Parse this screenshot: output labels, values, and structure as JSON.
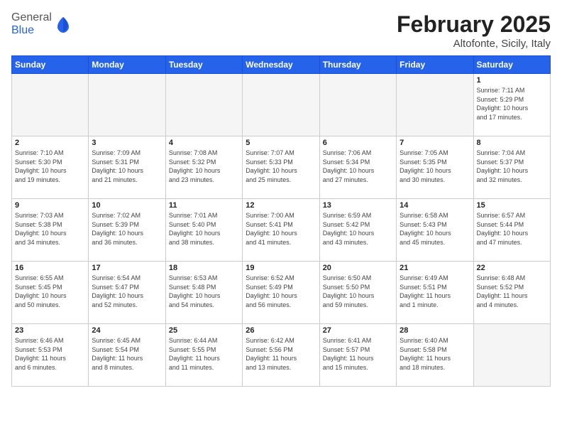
{
  "header": {
    "logo_general": "General",
    "logo_blue": "Blue",
    "month_title": "February 2025",
    "location": "Altofonte, Sicily, Italy"
  },
  "days_of_week": [
    "Sunday",
    "Monday",
    "Tuesday",
    "Wednesday",
    "Thursday",
    "Friday",
    "Saturday"
  ],
  "weeks": [
    [
      {
        "day": "",
        "info": ""
      },
      {
        "day": "",
        "info": ""
      },
      {
        "day": "",
        "info": ""
      },
      {
        "day": "",
        "info": ""
      },
      {
        "day": "",
        "info": ""
      },
      {
        "day": "",
        "info": ""
      },
      {
        "day": "1",
        "info": "Sunrise: 7:11 AM\nSunset: 5:29 PM\nDaylight: 10 hours\nand 17 minutes."
      }
    ],
    [
      {
        "day": "2",
        "info": "Sunrise: 7:10 AM\nSunset: 5:30 PM\nDaylight: 10 hours\nand 19 minutes."
      },
      {
        "day": "3",
        "info": "Sunrise: 7:09 AM\nSunset: 5:31 PM\nDaylight: 10 hours\nand 21 minutes."
      },
      {
        "day": "4",
        "info": "Sunrise: 7:08 AM\nSunset: 5:32 PM\nDaylight: 10 hours\nand 23 minutes."
      },
      {
        "day": "5",
        "info": "Sunrise: 7:07 AM\nSunset: 5:33 PM\nDaylight: 10 hours\nand 25 minutes."
      },
      {
        "day": "6",
        "info": "Sunrise: 7:06 AM\nSunset: 5:34 PM\nDaylight: 10 hours\nand 27 minutes."
      },
      {
        "day": "7",
        "info": "Sunrise: 7:05 AM\nSunset: 5:35 PM\nDaylight: 10 hours\nand 30 minutes."
      },
      {
        "day": "8",
        "info": "Sunrise: 7:04 AM\nSunset: 5:37 PM\nDaylight: 10 hours\nand 32 minutes."
      }
    ],
    [
      {
        "day": "9",
        "info": "Sunrise: 7:03 AM\nSunset: 5:38 PM\nDaylight: 10 hours\nand 34 minutes."
      },
      {
        "day": "10",
        "info": "Sunrise: 7:02 AM\nSunset: 5:39 PM\nDaylight: 10 hours\nand 36 minutes."
      },
      {
        "day": "11",
        "info": "Sunrise: 7:01 AM\nSunset: 5:40 PM\nDaylight: 10 hours\nand 38 minutes."
      },
      {
        "day": "12",
        "info": "Sunrise: 7:00 AM\nSunset: 5:41 PM\nDaylight: 10 hours\nand 41 minutes."
      },
      {
        "day": "13",
        "info": "Sunrise: 6:59 AM\nSunset: 5:42 PM\nDaylight: 10 hours\nand 43 minutes."
      },
      {
        "day": "14",
        "info": "Sunrise: 6:58 AM\nSunset: 5:43 PM\nDaylight: 10 hours\nand 45 minutes."
      },
      {
        "day": "15",
        "info": "Sunrise: 6:57 AM\nSunset: 5:44 PM\nDaylight: 10 hours\nand 47 minutes."
      }
    ],
    [
      {
        "day": "16",
        "info": "Sunrise: 6:55 AM\nSunset: 5:45 PM\nDaylight: 10 hours\nand 50 minutes."
      },
      {
        "day": "17",
        "info": "Sunrise: 6:54 AM\nSunset: 5:47 PM\nDaylight: 10 hours\nand 52 minutes."
      },
      {
        "day": "18",
        "info": "Sunrise: 6:53 AM\nSunset: 5:48 PM\nDaylight: 10 hours\nand 54 minutes."
      },
      {
        "day": "19",
        "info": "Sunrise: 6:52 AM\nSunset: 5:49 PM\nDaylight: 10 hours\nand 56 minutes."
      },
      {
        "day": "20",
        "info": "Sunrise: 6:50 AM\nSunset: 5:50 PM\nDaylight: 10 hours\nand 59 minutes."
      },
      {
        "day": "21",
        "info": "Sunrise: 6:49 AM\nSunset: 5:51 PM\nDaylight: 11 hours\nand 1 minute."
      },
      {
        "day": "22",
        "info": "Sunrise: 6:48 AM\nSunset: 5:52 PM\nDaylight: 11 hours\nand 4 minutes."
      }
    ],
    [
      {
        "day": "23",
        "info": "Sunrise: 6:46 AM\nSunset: 5:53 PM\nDaylight: 11 hours\nand 6 minutes."
      },
      {
        "day": "24",
        "info": "Sunrise: 6:45 AM\nSunset: 5:54 PM\nDaylight: 11 hours\nand 8 minutes."
      },
      {
        "day": "25",
        "info": "Sunrise: 6:44 AM\nSunset: 5:55 PM\nDaylight: 11 hours\nand 11 minutes."
      },
      {
        "day": "26",
        "info": "Sunrise: 6:42 AM\nSunset: 5:56 PM\nDaylight: 11 hours\nand 13 minutes."
      },
      {
        "day": "27",
        "info": "Sunrise: 6:41 AM\nSunset: 5:57 PM\nDaylight: 11 hours\nand 15 minutes."
      },
      {
        "day": "28",
        "info": "Sunrise: 6:40 AM\nSunset: 5:58 PM\nDaylight: 11 hours\nand 18 minutes."
      },
      {
        "day": "",
        "info": ""
      }
    ]
  ]
}
